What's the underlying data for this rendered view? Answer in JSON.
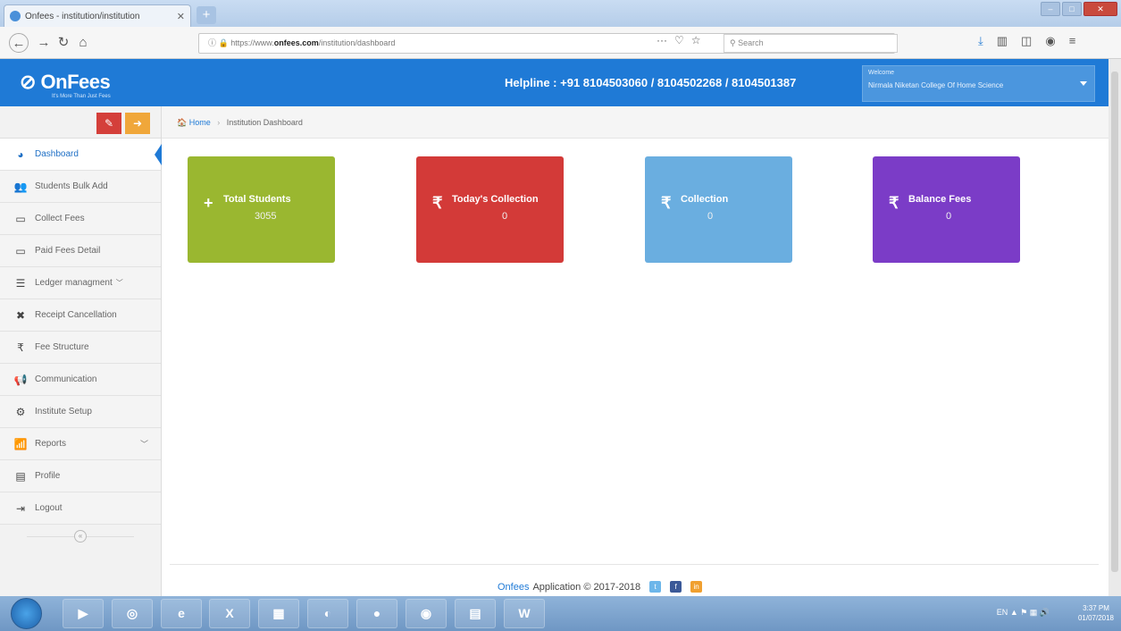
{
  "browser": {
    "tab_title": "Onfees - institution/institution",
    "tab_close": "✕",
    "new_tab": "+",
    "url_prefix": "https://www.",
    "url_host": "onfees.com",
    "url_path": "/institution/dashboard",
    "url_dots": "···",
    "search_placeholder": "Search"
  },
  "header": {
    "logo": "OnFees",
    "logo_tagline": "It's More Than Just Fees",
    "helpline": "Helpline : +91 8104503060 / 8104502268 / 8104501387",
    "welcome_label": "Welcome",
    "welcome_name": "Nirmala Niketan College Of Home Science"
  },
  "sidebar": {
    "items": [
      {
        "label": "Dashboard",
        "icon": "dashboard-icon"
      },
      {
        "label": "Students Bulk Add",
        "icon": "users-icon"
      },
      {
        "label": "Collect Fees",
        "icon": "card-icon"
      },
      {
        "label": "Paid Fees Detail",
        "icon": "card-icon"
      },
      {
        "label": "Ledger managment",
        "icon": "list-icon"
      },
      {
        "label": "Receipt Cancellation",
        "icon": "x-icon"
      },
      {
        "label": "Fee Structure",
        "icon": "rupee-icon"
      },
      {
        "label": "Communication",
        "icon": "megaphone-icon"
      },
      {
        "label": "Institute Setup",
        "icon": "gears-icon"
      },
      {
        "label": "Reports",
        "icon": "chart-icon"
      },
      {
        "label": "Profile",
        "icon": "id-card-icon"
      },
      {
        "label": "Logout",
        "icon": "logout-icon"
      }
    ]
  },
  "breadcrumb": {
    "home": "Home",
    "current": "Institution Dashboard"
  },
  "cards": [
    {
      "title": "Total Students",
      "value": "3055",
      "icon": "+",
      "color": "#9ab730"
    },
    {
      "title": "Today's Collection",
      "value": "0",
      "icon": "₹",
      "color": "#d33a38"
    },
    {
      "title": "Collection",
      "value": "0",
      "icon": "₹",
      "color": "#6aaee0"
    },
    {
      "title": "Balance Fees",
      "value": "0",
      "icon": "₹",
      "color": "#7b3cc7"
    }
  ],
  "footer": {
    "brand": "Onfees",
    "text": "Application © 2017-2018"
  },
  "taskbar": {
    "tray": "EN",
    "time": "3:37 PM",
    "date": "01/07/2018"
  }
}
